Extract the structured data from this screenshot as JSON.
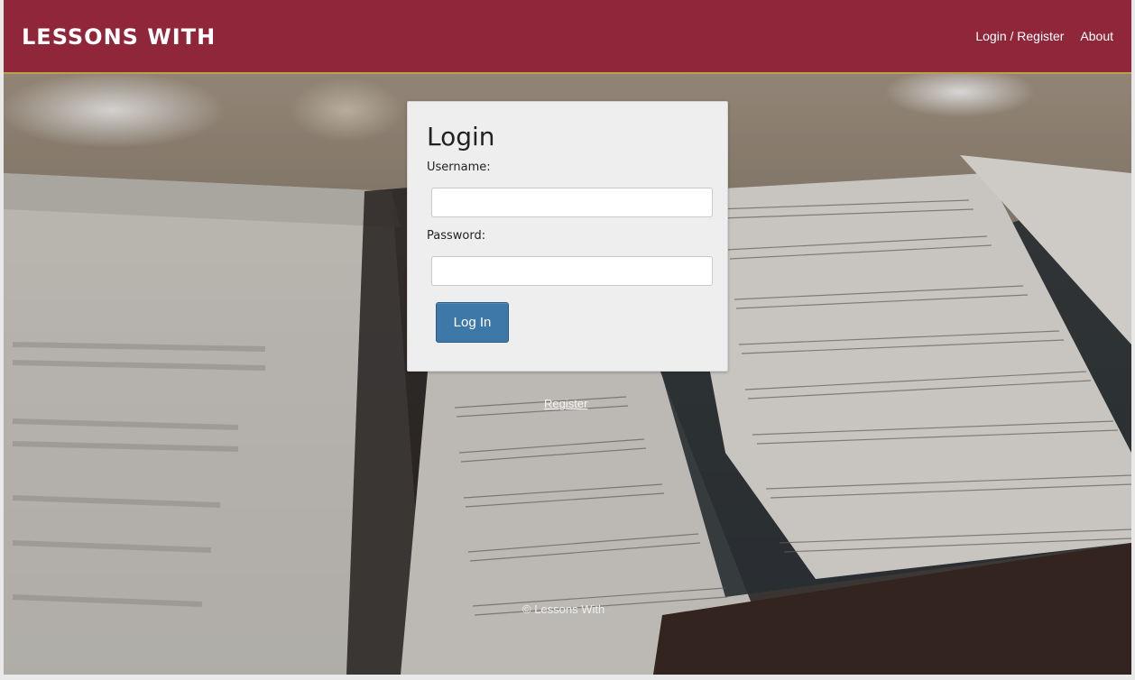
{
  "navbar": {
    "brand": "LESSONS WITH",
    "links": [
      "Login / Register",
      "About"
    ]
  },
  "login": {
    "title": "Login",
    "username_label": "Username:",
    "username_value": "",
    "password_label": "Password:",
    "password_value": "",
    "submit_label": "Log In"
  },
  "register_link": "Register",
  "footer": "© Lessons With",
  "colors": {
    "navbar": "#8f263a",
    "button": "#3e78a8",
    "card": "#eeeeee"
  }
}
